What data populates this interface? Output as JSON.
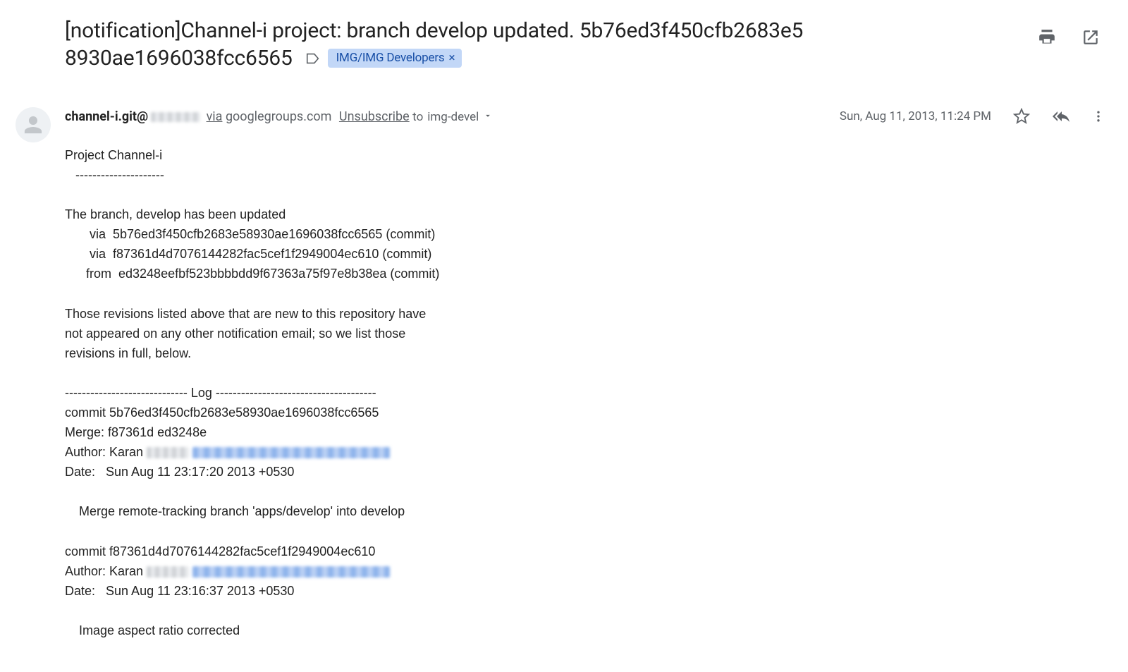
{
  "header": {
    "subject_line1": "[notification]Channel-i project: branch develop updated. 5b76ed3f450cfb2683e5",
    "subject_line2": "8930ae1696038fcc6565"
  },
  "label": {
    "text": "IMG/IMG Developers"
  },
  "actions": {
    "print_title": "Print",
    "open_title": "In new window"
  },
  "sender": {
    "name": "channel-i.git@",
    "via_word": "via",
    "via_domain": "googlegroups.com",
    "unsubscribe": "Unsubscribe",
    "to_prefix": "to ",
    "to_list": "img-devel"
  },
  "meta": {
    "datetime": "Sun, Aug 11, 2013, 11:24 PM"
  },
  "body": {
    "l01": "Project Channel-i",
    "l02": "   ---------------------",
    "l03": "",
    "l04": "The branch, develop has been updated",
    "l05": "       via  5b76ed3f450cfb2683e58930ae1696038fcc6565 (commit)",
    "l06": "       via  f87361d4d7076144282fac5cef1f2949004ec610 (commit)",
    "l07": "      from  ed3248eefbf523bbbbdd9f67363a75f97e8b38ea (commit)",
    "l08": "",
    "l09": "Those revisions listed above that are new to this repository have",
    "l10": "not appeared on any other notification email; so we list those",
    "l11": "revisions in full, below.",
    "l12": "",
    "l13": "----------------------------- Log --------------------------------------",
    "l14": "commit 5b76ed3f450cfb2683e58930ae1696038fcc6565",
    "l15": "Merge: f87361d ed3248e",
    "l16a": "Author: Karan ",
    "l17": "Date:   Sun Aug 11 23:17:20 2013 +0530",
    "l18": "",
    "l19": "    Merge remote-tracking branch 'apps/develop' into develop",
    "l20": "",
    "l21": "commit f87361d4d7076144282fac5cef1f2949004ec610",
    "l22a": "Author: Karan ",
    "l23": "Date:   Sun Aug 11 23:16:37 2013 +0530",
    "l24": "",
    "l25": "    Image aspect ratio corrected"
  }
}
